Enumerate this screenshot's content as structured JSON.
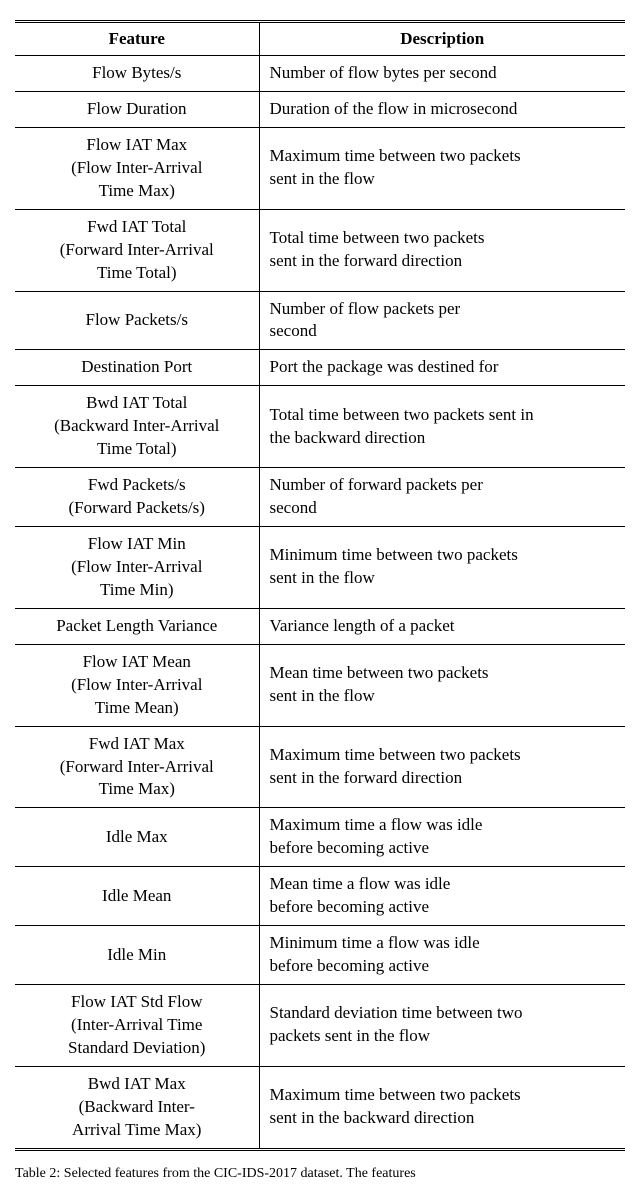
{
  "table": {
    "headers": {
      "feature": "Feature",
      "description": "Description"
    },
    "rows": [
      {
        "feature": "Flow Bytes/s",
        "description": "Number of flow bytes per second"
      },
      {
        "feature": "Flow Duration",
        "description": "Duration of the flow in microsecond"
      },
      {
        "feature": "Flow IAT Max\n(Flow Inter-Arrival\nTime Max)",
        "description": "Maximum time between two packets\nsent in the flow"
      },
      {
        "feature": "Fwd IAT Total\n(Forward Inter-Arrival\nTime Total)",
        "description": "Total time between two packets\nsent in the forward direction"
      },
      {
        "feature": "Flow Packets/s",
        "description": "Number of flow packets per\nsecond"
      },
      {
        "feature": "Destination Port",
        "description": "Port the package was destined for"
      },
      {
        "feature": "Bwd IAT Total\n(Backward Inter-Arrival\nTime Total)",
        "description": "Total time between two packets sent in\nthe backward direction"
      },
      {
        "feature": "Fwd Packets/s\n(Forward Packets/s)",
        "description": "Number of forward packets per\nsecond"
      },
      {
        "feature": "Flow IAT Min\n(Flow Inter-Arrival\nTime Min)",
        "description": "Minimum time between two packets\nsent in the flow"
      },
      {
        "feature": "Packet Length Variance",
        "description": "Variance length of a packet"
      },
      {
        "feature": "Flow IAT Mean\n(Flow Inter-Arrival\nTime Mean)",
        "description": "Mean time between two packets\nsent in the flow"
      },
      {
        "feature": "Fwd IAT Max\n(Forward Inter-Arrival\nTime Max)",
        "description": "Maximum time between two packets\nsent in the forward direction"
      },
      {
        "feature": "Idle Max",
        "description": "Maximum time a flow was idle\nbefore becoming active"
      },
      {
        "feature": "Idle Mean",
        "description": "Mean time a flow was idle\nbefore becoming active"
      },
      {
        "feature": "Idle Min",
        "description": "Minimum time a flow was idle\nbefore becoming active"
      },
      {
        "feature": "Flow IAT Std Flow\n(Inter-Arrival Time\nStandard Deviation)",
        "description": "Standard deviation time between two\npackets sent in the flow"
      },
      {
        "feature": "Bwd IAT Max\n(Backward Inter-\nArrival Time Max)",
        "description": "Maximum time between two packets\nsent in the backward direction"
      }
    ]
  },
  "caption": "Table 2: Selected features from the CIC-IDS-2017 dataset. The features"
}
